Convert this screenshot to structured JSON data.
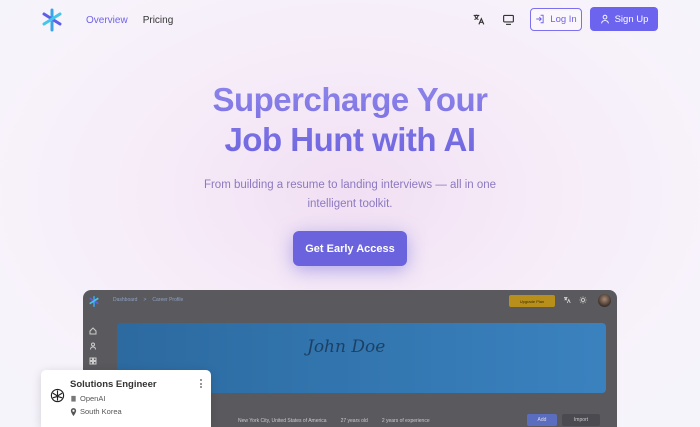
{
  "nav": {
    "links": [
      {
        "label": "Overview",
        "active": true
      },
      {
        "label": "Pricing",
        "active": false
      }
    ],
    "icons": [
      "translate-icon",
      "monitor-icon"
    ],
    "login_label": "Log In",
    "signup_label": "Sign Up"
  },
  "hero": {
    "title_line1": "Supercharge Your",
    "title_line2": "Job Hunt with AI",
    "subtitle": "From building a resume to landing interviews — all in one intelligent toolkit.",
    "cta_label": "Get Early Access"
  },
  "preview": {
    "breadcrumb": [
      "Dashboard",
      ">",
      "Career Profile"
    ],
    "upgrade_label": "Upgrade Plan",
    "signature": "John Doe",
    "info": [
      "New York City, United States of America",
      "27 years old",
      "2 years of experience"
    ],
    "add_label": "Add",
    "import_label": "Import"
  },
  "job_card": {
    "title": "Solutions Engineer",
    "company": "OpenAI",
    "location": "South Korea"
  },
  "colors": {
    "accent": "#6c63ee",
    "title_gradient_top": "#8f86ea",
    "subtitle": "#8d79c0"
  }
}
